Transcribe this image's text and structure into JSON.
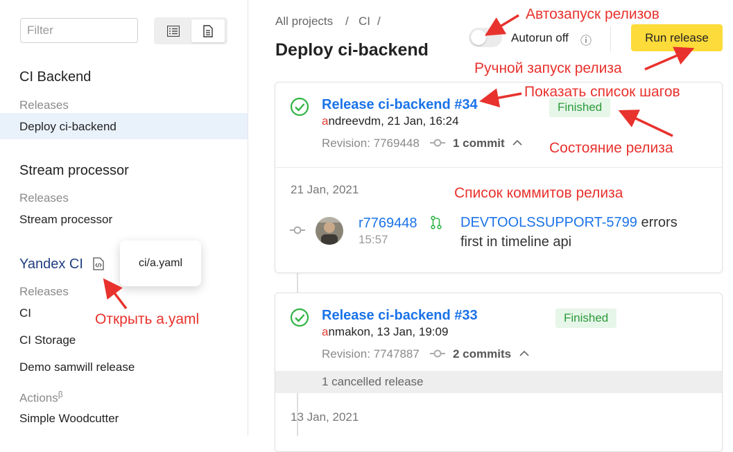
{
  "sidebar": {
    "filter_placeholder": "Filter",
    "projects": [
      {
        "title": "CI Backend",
        "section": "Releases",
        "items": [
          "Deploy ci-backend"
        ]
      },
      {
        "title": "Stream processor",
        "section": "Releases",
        "items": [
          "Stream processor"
        ]
      },
      {
        "title": "Yandex CI",
        "section": "Releases",
        "items": [
          "CI",
          "CI Storage",
          "Demo samwill release"
        ],
        "actions_label": "Actions",
        "actions_sup": "β",
        "actions_items": [
          "Simple Woodcutter"
        ]
      }
    ],
    "tooltip": "ci/a.yaml"
  },
  "header": {
    "breadcrumbs": [
      "All projects",
      "/",
      "CI",
      "/"
    ],
    "title": "Deploy ci-backend",
    "autorun_label": "Autorun off",
    "info_icon": "ⓘ",
    "run_button": "Run release"
  },
  "releases": [
    {
      "title": "Release ci-backend #34",
      "author_first": "a",
      "author_rest": "ndreevdm, 21 Jan, 16:24",
      "revision": "Revision: 7769448",
      "commits": "1 commit",
      "status": "Finished",
      "date": "21 Jan, 2021",
      "commit": {
        "rev": "r7769448",
        "time": "15:57",
        "ticket": "DEVTOOLSSUPPORT-5799",
        "msg_rest": " errors first in timeline api"
      }
    },
    {
      "title": "Release ci-backend #33",
      "author_first": "a",
      "author_rest": "nmakon, 13 Jan, 19:09",
      "revision": "Revision: 7747887",
      "commits": "2 commits",
      "status": "Finished",
      "cancelled": "1 cancelled release",
      "date": "13 Jan, 2021"
    }
  ],
  "annotations": {
    "autorun": "Автозапуск релизов",
    "manual_run": "Ручной запуск релиза",
    "show_steps": "Показать список шагов",
    "status": "Состояние релиза",
    "commits_list": "Список коммитов релиза",
    "open_yaml": "Открыть a.yaml"
  },
  "colors": {
    "accent": "#fddb3a",
    "link": "#1a73e8",
    "success": "#2c9a3b",
    "annotation": "#e8322d"
  }
}
